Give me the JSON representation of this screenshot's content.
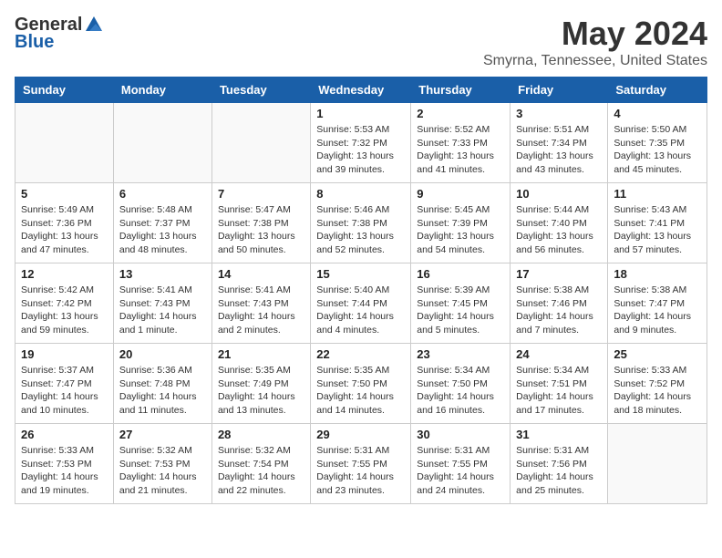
{
  "header": {
    "logo_general": "General",
    "logo_blue": "Blue",
    "title": "May 2024",
    "location": "Smyrna, Tennessee, United States"
  },
  "days_of_week": [
    "Sunday",
    "Monday",
    "Tuesday",
    "Wednesday",
    "Thursday",
    "Friday",
    "Saturday"
  ],
  "weeks": [
    [
      {
        "day": "",
        "info": ""
      },
      {
        "day": "",
        "info": ""
      },
      {
        "day": "",
        "info": ""
      },
      {
        "day": "1",
        "info": "Sunrise: 5:53 AM\nSunset: 7:32 PM\nDaylight: 13 hours and 39 minutes."
      },
      {
        "day": "2",
        "info": "Sunrise: 5:52 AM\nSunset: 7:33 PM\nDaylight: 13 hours and 41 minutes."
      },
      {
        "day": "3",
        "info": "Sunrise: 5:51 AM\nSunset: 7:34 PM\nDaylight: 13 hours and 43 minutes."
      },
      {
        "day": "4",
        "info": "Sunrise: 5:50 AM\nSunset: 7:35 PM\nDaylight: 13 hours and 45 minutes."
      }
    ],
    [
      {
        "day": "5",
        "info": "Sunrise: 5:49 AM\nSunset: 7:36 PM\nDaylight: 13 hours and 47 minutes."
      },
      {
        "day": "6",
        "info": "Sunrise: 5:48 AM\nSunset: 7:37 PM\nDaylight: 13 hours and 48 minutes."
      },
      {
        "day": "7",
        "info": "Sunrise: 5:47 AM\nSunset: 7:38 PM\nDaylight: 13 hours and 50 minutes."
      },
      {
        "day": "8",
        "info": "Sunrise: 5:46 AM\nSunset: 7:38 PM\nDaylight: 13 hours and 52 minutes."
      },
      {
        "day": "9",
        "info": "Sunrise: 5:45 AM\nSunset: 7:39 PM\nDaylight: 13 hours and 54 minutes."
      },
      {
        "day": "10",
        "info": "Sunrise: 5:44 AM\nSunset: 7:40 PM\nDaylight: 13 hours and 56 minutes."
      },
      {
        "day": "11",
        "info": "Sunrise: 5:43 AM\nSunset: 7:41 PM\nDaylight: 13 hours and 57 minutes."
      }
    ],
    [
      {
        "day": "12",
        "info": "Sunrise: 5:42 AM\nSunset: 7:42 PM\nDaylight: 13 hours and 59 minutes."
      },
      {
        "day": "13",
        "info": "Sunrise: 5:41 AM\nSunset: 7:43 PM\nDaylight: 14 hours and 1 minute."
      },
      {
        "day": "14",
        "info": "Sunrise: 5:41 AM\nSunset: 7:43 PM\nDaylight: 14 hours and 2 minutes."
      },
      {
        "day": "15",
        "info": "Sunrise: 5:40 AM\nSunset: 7:44 PM\nDaylight: 14 hours and 4 minutes."
      },
      {
        "day": "16",
        "info": "Sunrise: 5:39 AM\nSunset: 7:45 PM\nDaylight: 14 hours and 5 minutes."
      },
      {
        "day": "17",
        "info": "Sunrise: 5:38 AM\nSunset: 7:46 PM\nDaylight: 14 hours and 7 minutes."
      },
      {
        "day": "18",
        "info": "Sunrise: 5:38 AM\nSunset: 7:47 PM\nDaylight: 14 hours and 9 minutes."
      }
    ],
    [
      {
        "day": "19",
        "info": "Sunrise: 5:37 AM\nSunset: 7:47 PM\nDaylight: 14 hours and 10 minutes."
      },
      {
        "day": "20",
        "info": "Sunrise: 5:36 AM\nSunset: 7:48 PM\nDaylight: 14 hours and 11 minutes."
      },
      {
        "day": "21",
        "info": "Sunrise: 5:35 AM\nSunset: 7:49 PM\nDaylight: 14 hours and 13 minutes."
      },
      {
        "day": "22",
        "info": "Sunrise: 5:35 AM\nSunset: 7:50 PM\nDaylight: 14 hours and 14 minutes."
      },
      {
        "day": "23",
        "info": "Sunrise: 5:34 AM\nSunset: 7:50 PM\nDaylight: 14 hours and 16 minutes."
      },
      {
        "day": "24",
        "info": "Sunrise: 5:34 AM\nSunset: 7:51 PM\nDaylight: 14 hours and 17 minutes."
      },
      {
        "day": "25",
        "info": "Sunrise: 5:33 AM\nSunset: 7:52 PM\nDaylight: 14 hours and 18 minutes."
      }
    ],
    [
      {
        "day": "26",
        "info": "Sunrise: 5:33 AM\nSunset: 7:53 PM\nDaylight: 14 hours and 19 minutes."
      },
      {
        "day": "27",
        "info": "Sunrise: 5:32 AM\nSunset: 7:53 PM\nDaylight: 14 hours and 21 minutes."
      },
      {
        "day": "28",
        "info": "Sunrise: 5:32 AM\nSunset: 7:54 PM\nDaylight: 14 hours and 22 minutes."
      },
      {
        "day": "29",
        "info": "Sunrise: 5:31 AM\nSunset: 7:55 PM\nDaylight: 14 hours and 23 minutes."
      },
      {
        "day": "30",
        "info": "Sunrise: 5:31 AM\nSunset: 7:55 PM\nDaylight: 14 hours and 24 minutes."
      },
      {
        "day": "31",
        "info": "Sunrise: 5:31 AM\nSunset: 7:56 PM\nDaylight: 14 hours and 25 minutes."
      },
      {
        "day": "",
        "info": ""
      }
    ]
  ]
}
